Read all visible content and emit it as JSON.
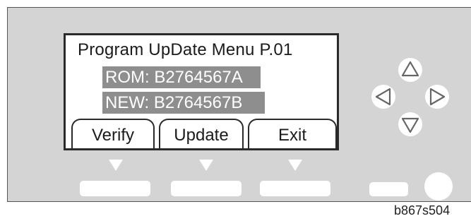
{
  "lcd": {
    "title": "Program UpDate Menu P.01",
    "rom_line": "ROM: B2764567A",
    "new_line": "NEW: B2764567B"
  },
  "softkeys": [
    {
      "label": "Verify"
    },
    {
      "label": "Update"
    },
    {
      "label": "Exit"
    }
  ],
  "figure_id": "b867s504",
  "colors": {
    "panel": "#d4d4d4",
    "highlight": "#8e8e8e",
    "lcd_background": "#ffffff"
  },
  "icons": [
    "arrow-up-icon",
    "arrow-left-icon",
    "arrow-right-icon",
    "arrow-down-icon"
  ]
}
